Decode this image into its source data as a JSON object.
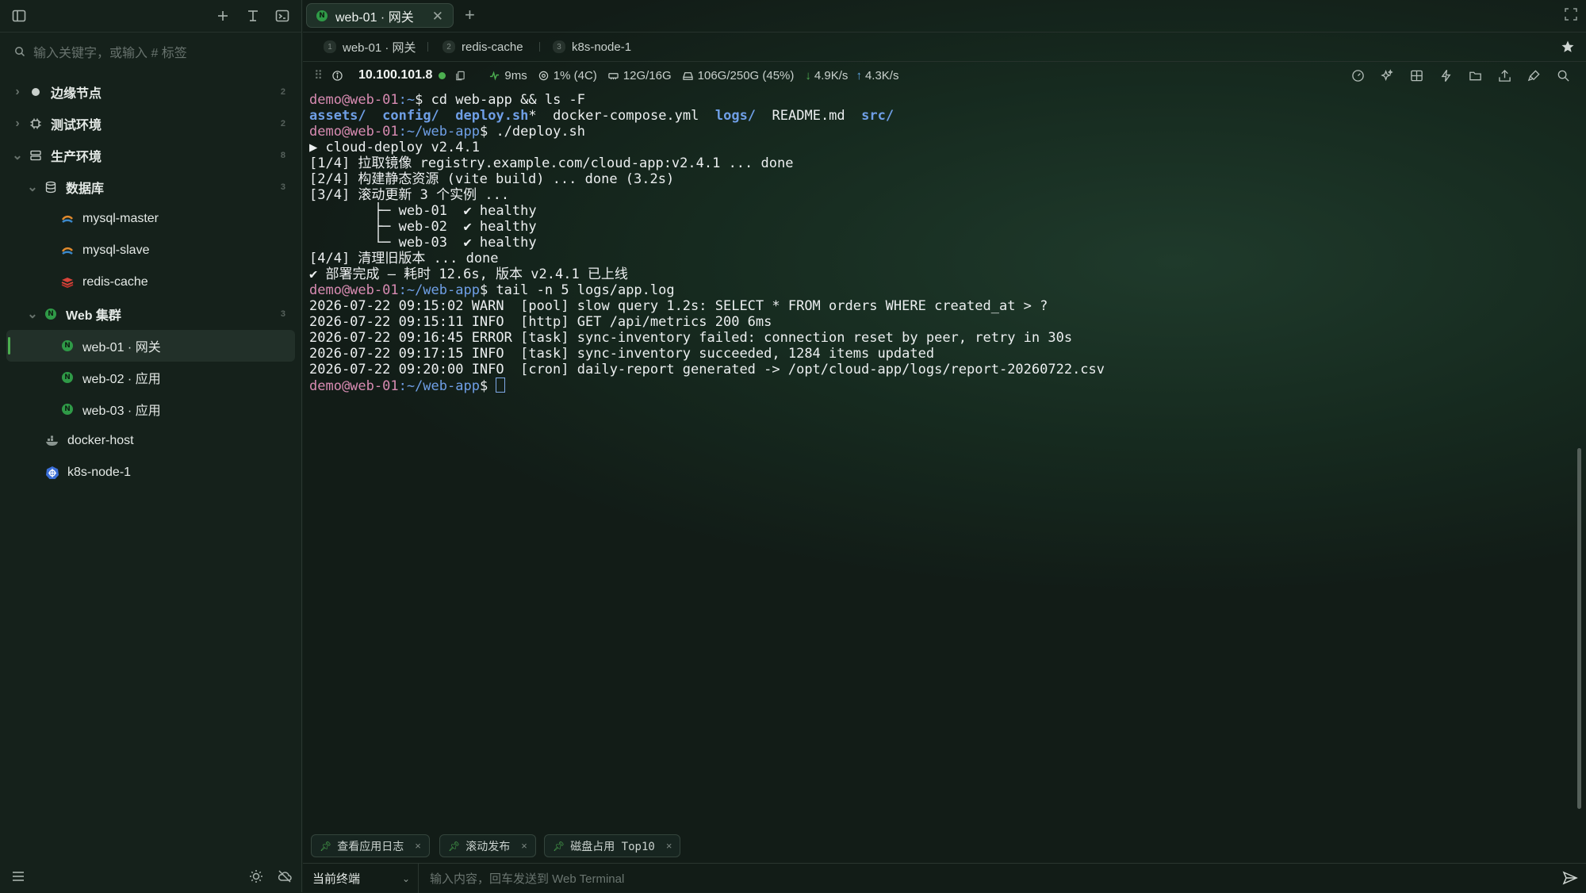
{
  "sidebar": {
    "search_placeholder": "输入关键字，或输入 # 标签",
    "tree": [
      {
        "label": "边缘节点",
        "count": "2",
        "icon": "edge-node-icon"
      },
      {
        "label": "测试环境",
        "count": "2",
        "icon": "chip-icon"
      },
      {
        "label": "生产环境",
        "count": "8",
        "icon": "server-icon"
      },
      {
        "label": "数据库",
        "count": "3",
        "icon": "database-icon"
      },
      {
        "label": "mysql-master",
        "icon": "mysql-icon"
      },
      {
        "label": "mysql-slave",
        "icon": "mysql-icon"
      },
      {
        "label": "redis-cache",
        "icon": "redis-icon"
      },
      {
        "label": "Web 集群",
        "count": "3",
        "icon": "nginx-icon"
      },
      {
        "label": "web-01 · 网关",
        "icon": "nginx-icon"
      },
      {
        "label": "web-02 · 应用",
        "icon": "nginx-icon"
      },
      {
        "label": "web-03 · 应用",
        "icon": "nginx-icon"
      },
      {
        "label": "docker-host",
        "icon": "docker-icon"
      },
      {
        "label": "k8s-node-1",
        "icon": "kubernetes-icon"
      }
    ]
  },
  "tabs": {
    "active_label": "web-01 · 网关",
    "active_icon": "N"
  },
  "sessions": [
    {
      "num": "1",
      "label": "web-01 · 网关"
    },
    {
      "num": "2",
      "label": "redis-cache"
    },
    {
      "num": "3",
      "label": "k8s-node-1"
    }
  ],
  "status": {
    "ip": "10.100.101.8",
    "latency": "9ms",
    "cpu": "1% (4C)",
    "mem": "12G/16G",
    "disk": "106G/250G (45%)",
    "down": "4.9K/s",
    "up": "4.3K/s",
    "status_color": "#4caf50"
  },
  "terminal": {
    "user": "demo@web-01",
    "path_home": ":~",
    "path_app": ":~/web-app",
    "prompt": "$ ",
    "cmd1": "cd web-app && ls -F",
    "ls": {
      "assets": "assets/",
      "config": "config/",
      "deploy": "deploy.sh",
      "star": "*",
      "compose": "docker-compose.yml",
      "logs": "logs/",
      "readme": "README.md",
      "src": "src/"
    },
    "cmd2": "./deploy.sh",
    "deploy_lines": [
      "▶ cloud-deploy v2.4.1",
      "[1/4] 拉取镜像 registry.example.com/cloud-app:v2.4.1 ... done",
      "[2/4] 构建静态资源 (vite build) ... done (3.2s)",
      "[3/4] 滚动更新 3 个实例 ...",
      "        ├─ web-01  ✔ healthy",
      "        ├─ web-02  ✔ healthy",
      "        └─ web-03  ✔ healthy",
      "[4/4] 清理旧版本 ... done",
      "✔ 部署完成 — 耗时 12.6s, 版本 v2.4.1 已上线"
    ],
    "cmd3": "tail -n 5 logs/app.log",
    "log_lines": [
      "2026-07-22 09:15:02 WARN  [pool] slow query 1.2s: SELECT * FROM orders WHERE created_at > ?",
      "2026-07-22 09:15:11 INFO  [http] GET /api/metrics 200 6ms",
      "2026-07-22 09:16:45 ERROR [task] sync-inventory failed: connection reset by peer, retry in 30s",
      "2026-07-22 09:17:15 INFO  [task] sync-inventory succeeded, 1284 items updated",
      "2026-07-22 09:20:00 INFO  [cron] daily-report generated -> /opt/cloud-app/logs/report-20260722.csv"
    ]
  },
  "quick_commands": [
    "查看应用日志",
    "滚动发布",
    "磁盘占用 Top10"
  ],
  "input": {
    "target": "当前终端",
    "placeholder": "输入内容，回车发送到 Web Terminal"
  }
}
